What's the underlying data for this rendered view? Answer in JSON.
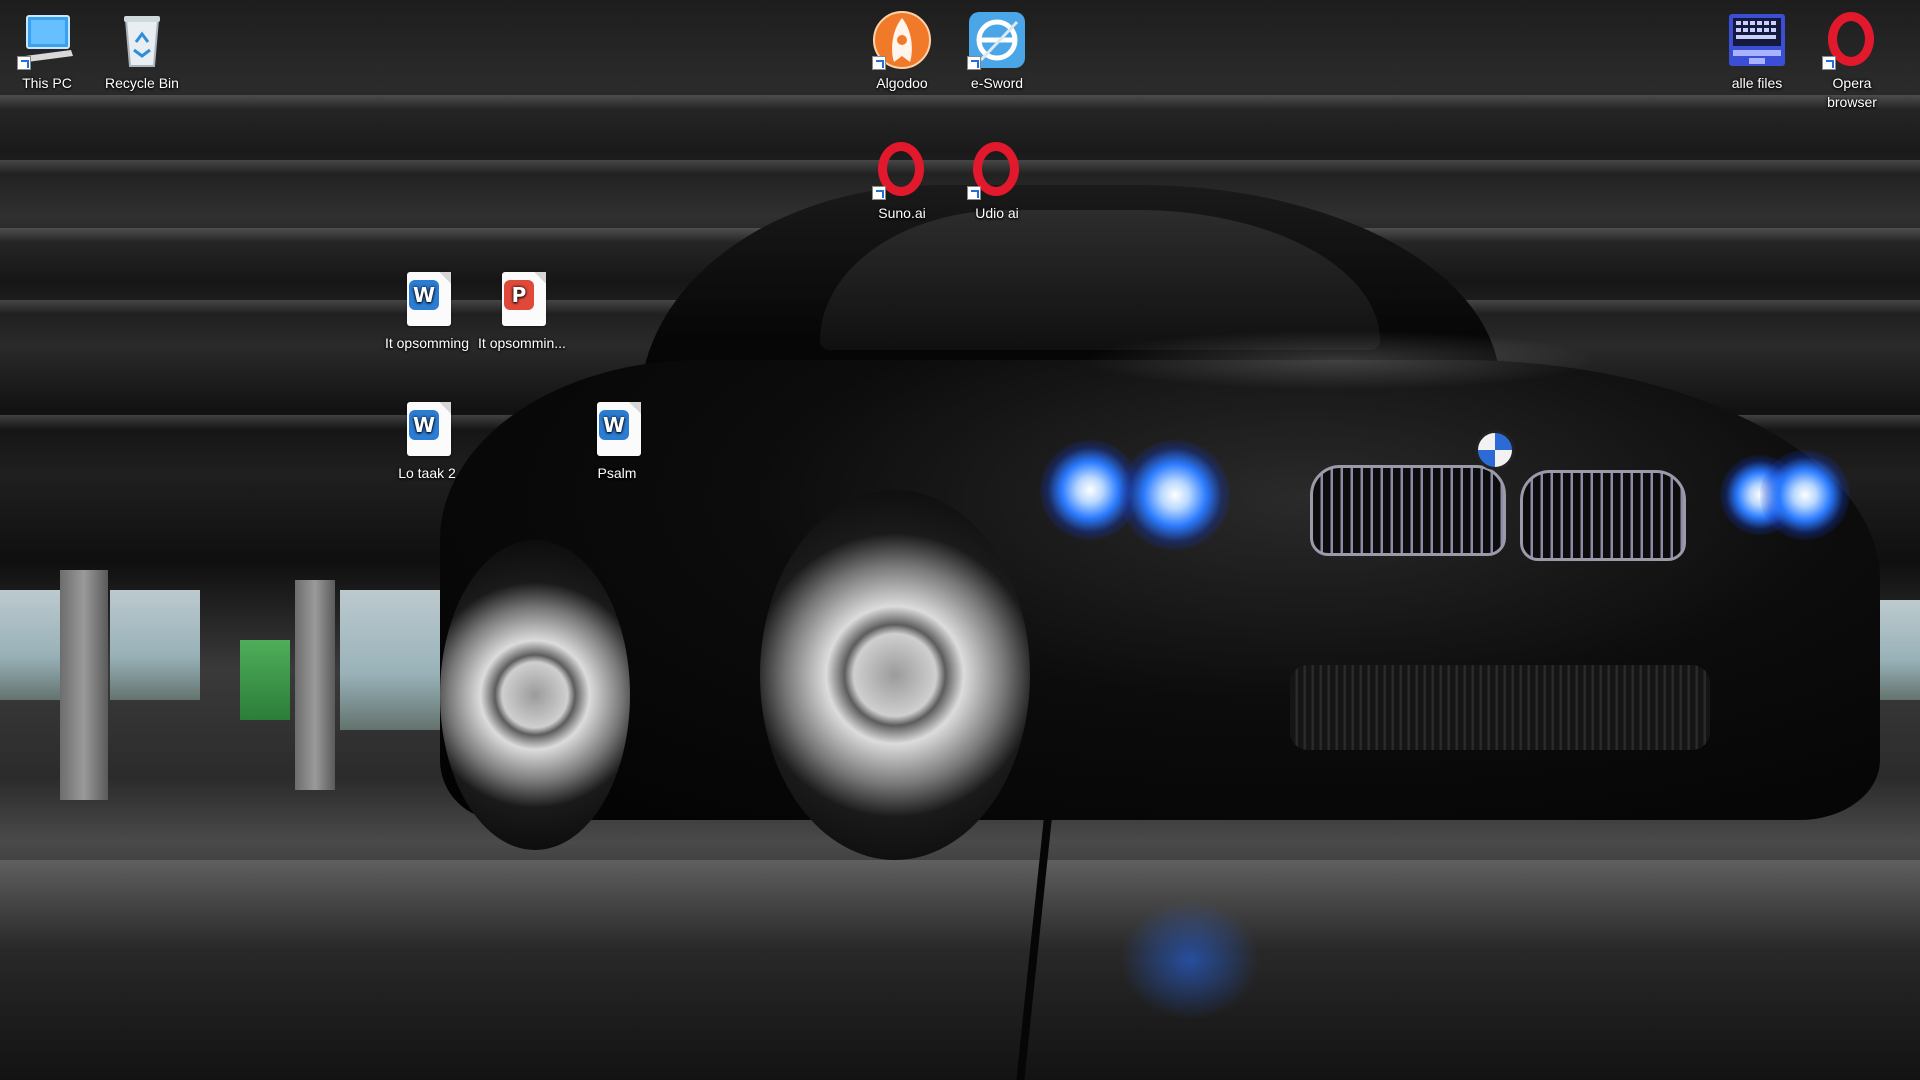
{
  "desktop": {
    "icons": {
      "this_pc": {
        "label": "This PC",
        "icon": "monitor-icon"
      },
      "recycle_bin": {
        "label": "Recycle Bin",
        "icon": "recycle-bin-icon"
      },
      "algodoo": {
        "label": "Algodoo",
        "icon": "algodoo-icon"
      },
      "e_sword": {
        "label": "e-Sword",
        "icon": "e-sword-icon"
      },
      "suno": {
        "label": "Suno.ai",
        "icon": "opera-icon"
      },
      "udio": {
        "label": "Udio ai",
        "icon": "opera-icon"
      },
      "alle_files": {
        "label": "alle files",
        "icon": "keyboard-folder-icon"
      },
      "opera_browser": {
        "label": "Opera browser",
        "icon": "opera-icon"
      },
      "it_opsomming_doc": {
        "label": "It opsomming",
        "icon": "word-document-icon",
        "badge": "W"
      },
      "it_opsomming_ppt": {
        "label": "It opsommin...",
        "icon": "presentation-document-icon",
        "badge": "P"
      },
      "lo_taak": {
        "label": "Lo taak 2",
        "icon": "word-document-icon",
        "badge": "W"
      },
      "psalm": {
        "label": "Psalm",
        "icon": "word-document-icon",
        "badge": "W"
      }
    }
  },
  "colors": {
    "word_blue": "#2b7cd3",
    "ppt_red": "#e0483a",
    "opera_red": "#e2192c",
    "headlight_blue": "#2b7bff"
  }
}
